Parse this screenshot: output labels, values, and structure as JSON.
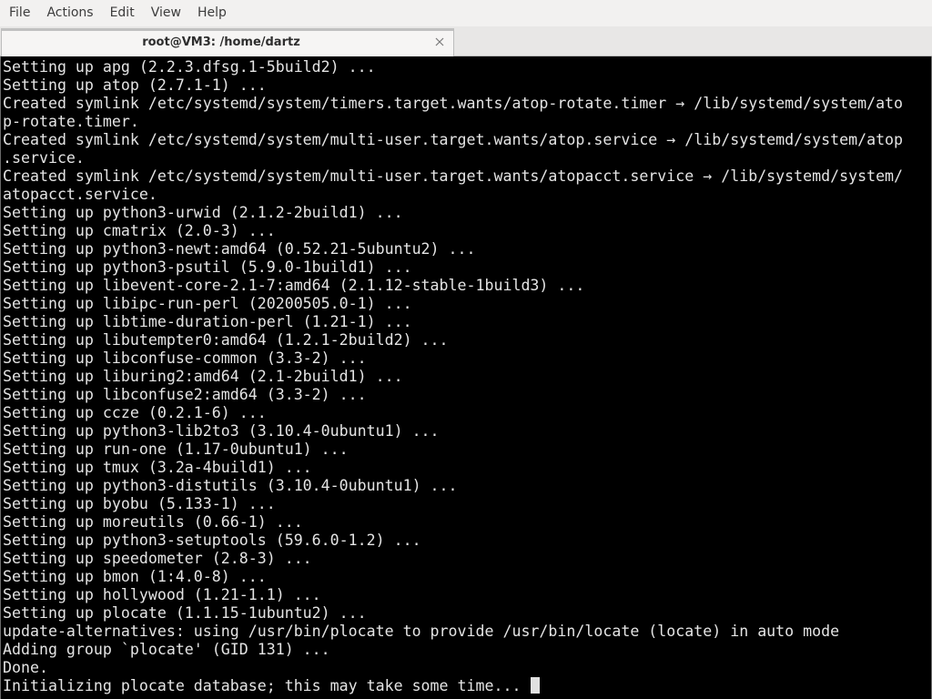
{
  "menubar": {
    "items": [
      "File",
      "Actions",
      "Edit",
      "View",
      "Help"
    ]
  },
  "tab": {
    "title": "root@VM3: /home/dartz",
    "close_icon": "close-icon"
  },
  "colors": {
    "terminal_bg": "#000000",
    "terminal_fg": "#e4e4e4"
  },
  "terminal": {
    "lines": [
      "Setting up apg (2.2.3.dfsg.1-5build2) ...",
      "Setting up atop (2.7.1-1) ...",
      "Created symlink /etc/systemd/system/timers.target.wants/atop-rotate.timer → /lib/systemd/system/ato",
      "p-rotate.timer.",
      "Created symlink /etc/systemd/system/multi-user.target.wants/atop.service → /lib/systemd/system/atop",
      ".service.",
      "Created symlink /etc/systemd/system/multi-user.target.wants/atopacct.service → /lib/systemd/system/",
      "atopacct.service.",
      "Setting up python3-urwid (2.1.2-2build1) ...",
      "Setting up cmatrix (2.0-3) ...",
      "Setting up python3-newt:amd64 (0.52.21-5ubuntu2) ...",
      "Setting up python3-psutil (5.9.0-1build1) ...",
      "Setting up libevent-core-2.1-7:amd64 (2.1.12-stable-1build3) ...",
      "Setting up libipc-run-perl (20200505.0-1) ...",
      "Setting up libtime-duration-perl (1.21-1) ...",
      "Setting up libutempter0:amd64 (1.2.1-2build2) ...",
      "Setting up libconfuse-common (3.3-2) ...",
      "Setting up liburing2:amd64 (2.1-2build1) ...",
      "Setting up libconfuse2:amd64 (3.3-2) ...",
      "Setting up ccze (0.2.1-6) ...",
      "Setting up python3-lib2to3 (3.10.4-0ubuntu1) ...",
      "Setting up run-one (1.17-0ubuntu1) ...",
      "Setting up tmux (3.2a-4build1) ...",
      "Setting up python3-distutils (3.10.4-0ubuntu1) ...",
      "Setting up byobu (5.133-1) ...",
      "Setting up moreutils (0.66-1) ...",
      "Setting up python3-setuptools (59.6.0-1.2) ...",
      "Setting up speedometer (2.8-3) ...",
      "Setting up bmon (1:4.0-8) ...",
      "Setting up hollywood (1.21-1.1) ...",
      "Setting up plocate (1.1.15-1ubuntu2) ...",
      "update-alternatives: using /usr/bin/plocate to provide /usr/bin/locate (locate) in auto mode",
      "Adding group `plocate' (GID 131) ...",
      "Done.",
      "Initializing plocate database; this may take some time... "
    ]
  }
}
